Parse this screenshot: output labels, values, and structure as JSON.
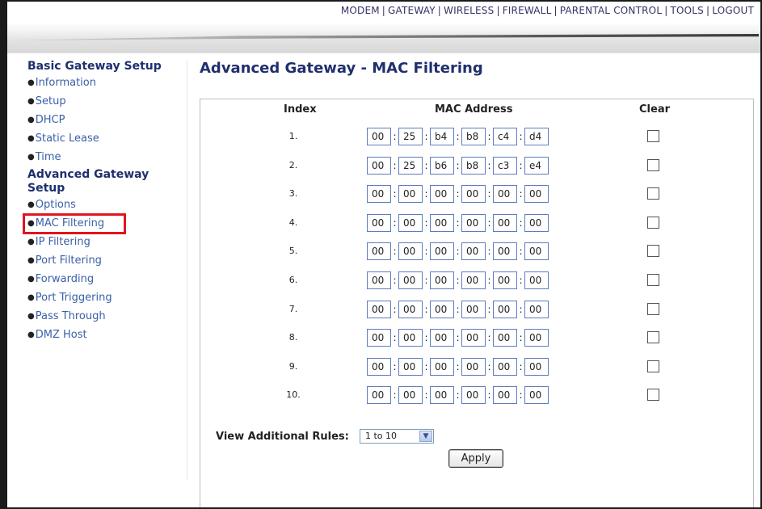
{
  "topnav": {
    "items": [
      "MODEM",
      "GATEWAY",
      "WIRELESS",
      "FIREWALL",
      "PARENTAL CONTROL",
      "TOOLS",
      "LOGOUT"
    ]
  },
  "sidebar": {
    "section1": "Basic Gateway Setup",
    "basic_items": [
      "Information",
      "Setup",
      "DHCP",
      "Static Lease",
      "Time"
    ],
    "section2": "Advanced Gateway Setup",
    "advanced_items": [
      "Options",
      "MAC Filtering",
      "IP Filtering",
      "Port Filtering",
      "Forwarding",
      "Port Triggering",
      "Pass Through",
      "DMZ Host"
    ]
  },
  "page": {
    "title": "Advanced Gateway - MAC Filtering"
  },
  "table": {
    "headers": {
      "index": "Index",
      "mac": "MAC Address",
      "clear": "Clear"
    },
    "rows": [
      {
        "index": "1.",
        "mac": [
          "00",
          "25",
          "b4",
          "b8",
          "c4",
          "d4"
        ]
      },
      {
        "index": "2.",
        "mac": [
          "00",
          "25",
          "b6",
          "b8",
          "c3",
          "e4"
        ]
      },
      {
        "index": "3.",
        "mac": [
          "00",
          "00",
          "00",
          "00",
          "00",
          "00"
        ]
      },
      {
        "index": "4.",
        "mac": [
          "00",
          "00",
          "00",
          "00",
          "00",
          "00"
        ]
      },
      {
        "index": "5.",
        "mac": [
          "00",
          "00",
          "00",
          "00",
          "00",
          "00"
        ]
      },
      {
        "index": "6.",
        "mac": [
          "00",
          "00",
          "00",
          "00",
          "00",
          "00"
        ]
      },
      {
        "index": "7.",
        "mac": [
          "00",
          "00",
          "00",
          "00",
          "00",
          "00"
        ]
      },
      {
        "index": "8.",
        "mac": [
          "00",
          "00",
          "00",
          "00",
          "00",
          "00"
        ]
      },
      {
        "index": "9.",
        "mac": [
          "00",
          "00",
          "00",
          "00",
          "00",
          "00"
        ]
      },
      {
        "index": "10.",
        "mac": [
          "00",
          "00",
          "00",
          "00",
          "00",
          "00"
        ]
      }
    ]
  },
  "controls": {
    "view_label": "View Additional Rules:",
    "view_select": "1 to 10",
    "apply_label": "Apply"
  },
  "colors": {
    "heading": "#1f2f6e",
    "link": "#3a60a8",
    "highlight_box": "#e0151f"
  }
}
